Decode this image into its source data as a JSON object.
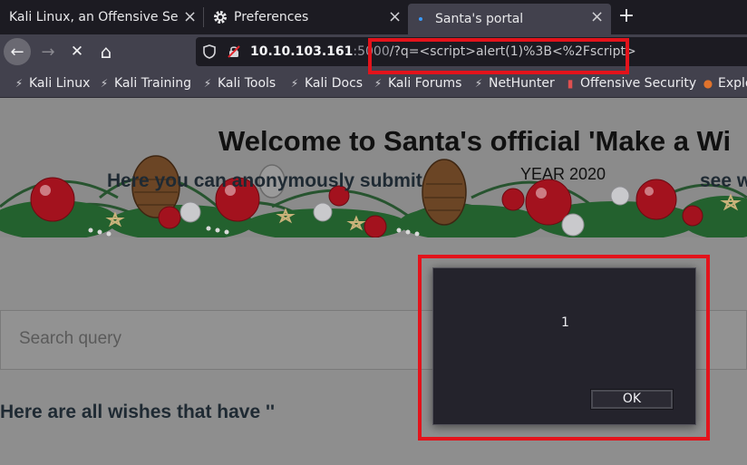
{
  "tabs": [
    {
      "title": "Kali Linux, an Offensive Security",
      "active": false
    },
    {
      "title": "Preferences",
      "active": false,
      "icon": "gear-icon"
    },
    {
      "title": "Santa's portal",
      "active": true,
      "loading": true
    }
  ],
  "close_glyph": "×",
  "newtab_glyph": "+",
  "navigation": {
    "back_icon": "←",
    "forward_icon": "→",
    "stop_icon": "✕",
    "home_icon": "⌂"
  },
  "url": {
    "host": "10.10.103.161",
    "port": ":5000",
    "query": "/?q=<script>alert(1)%3B<%2Fscript>"
  },
  "bookmarks": [
    {
      "label": "Kali Linux"
    },
    {
      "label": "Kali Training"
    },
    {
      "label": "Kali Tools"
    },
    {
      "label": "Kali Docs"
    },
    {
      "label": "Kali Forums"
    },
    {
      "label": "NetHunter"
    },
    {
      "label": "Offensive Security"
    },
    {
      "label": "Exploi"
    }
  ],
  "page": {
    "banner_title": "Welcome to Santa's official 'Make a Wi",
    "banner_year": "YEAR 2020",
    "intro_left": "Here you can anonymously submit",
    "intro_right": "see w",
    "search_placeholder": "Search query",
    "wishes_heading": "Here are all wishes that have ''"
  },
  "dialog": {
    "message": "1",
    "ok_label": "OK"
  },
  "colors": {
    "highlight": "#e3131b",
    "ornament_red": "#a3121e",
    "pine_green": "#1f5a2a"
  }
}
